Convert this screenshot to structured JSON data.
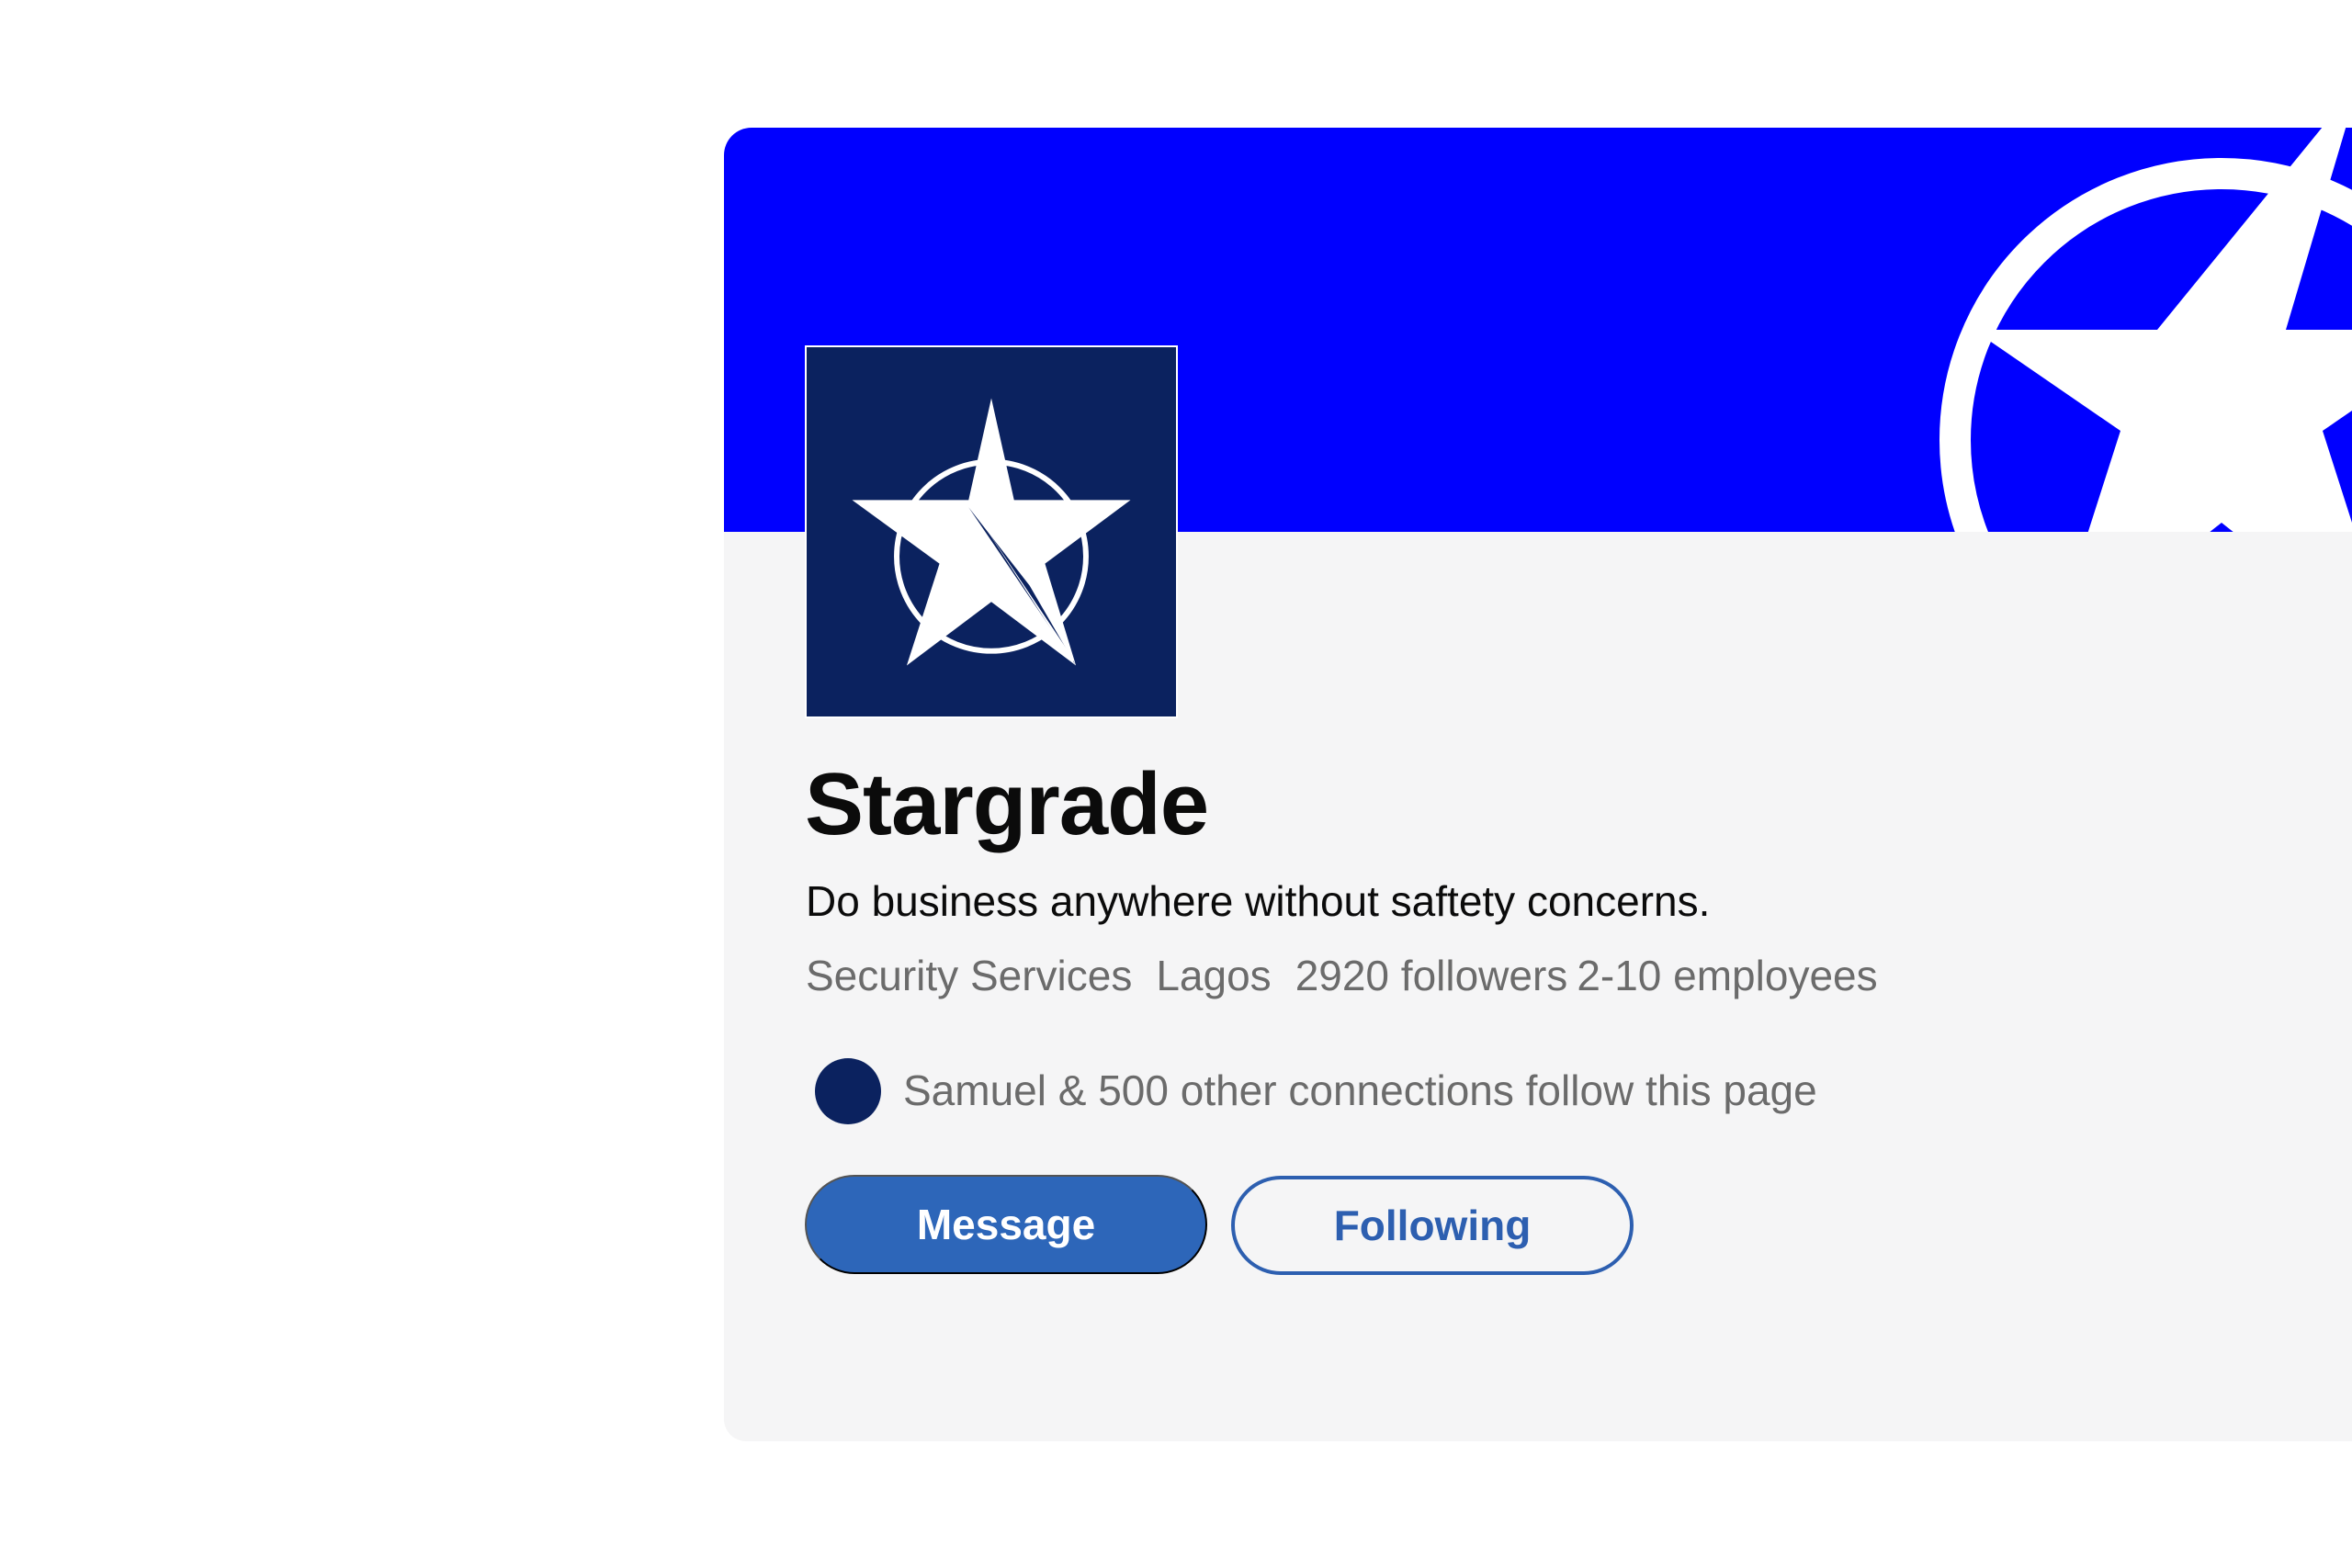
{
  "colors": {
    "banner": "#0000ff",
    "logo_bg": "#0b225f",
    "card_bg": "#f5f5f6",
    "primary_button": "#2d66b9",
    "secondary_text": "#6b6b6b"
  },
  "company": {
    "name": "Stargrade",
    "tagline": "Do business anywhere without saftety concerns.",
    "industry": "Security Services",
    "location": "Lagos",
    "followers": "2920 followers",
    "size": "2-10 employees",
    "logo_icon": "star-in-circle-icon"
  },
  "connections": {
    "text": "Samuel & 500 other connections follow this page"
  },
  "actions": {
    "message_label": "Message",
    "following_label": "Following"
  }
}
